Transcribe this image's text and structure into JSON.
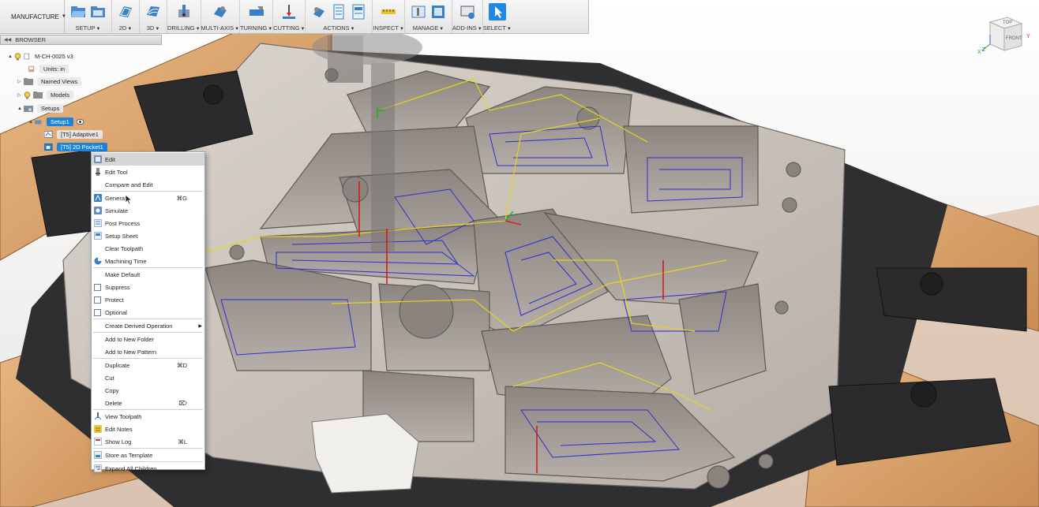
{
  "toolbar": {
    "workspace": "MANUFACTURE",
    "groups": [
      {
        "label": "SETUP",
        "icons": [
          "folder-open-icon",
          "folder-setup-icon"
        ]
      },
      {
        "label": "2D",
        "icons": [
          "2d-contour-icon"
        ]
      },
      {
        "label": "3D",
        "icons": [
          "3d-surface-icon"
        ]
      },
      {
        "label": "DRILLING",
        "icons": [
          "drill-icon"
        ]
      },
      {
        "label": "MULTI-AXIS",
        "icons": [
          "multi-axis-icon"
        ]
      },
      {
        "label": "TURNING",
        "icons": [
          "turning-icon"
        ]
      },
      {
        "label": "CUTTING",
        "icons": [
          "cutting-icon"
        ]
      },
      {
        "label": "ACTIONS",
        "icons": [
          "simulate-action-icon",
          "post-process-icon",
          "setup-sheet-icon"
        ]
      },
      {
        "label": "INSPECT",
        "icons": [
          "measure-icon"
        ]
      },
      {
        "label": "MANAGE",
        "icons": [
          "tool-library-icon",
          "template-icon"
        ]
      },
      {
        "label": "ADD-INS",
        "icons": [
          "add-ins-icon"
        ]
      },
      {
        "label": "SELECT",
        "icons": [
          "select-cursor-icon"
        ]
      }
    ],
    "colors": {
      "active": "#1e88e5",
      "icon_blue": "#3b7fc4"
    }
  },
  "viewcube": {
    "top": "TOP",
    "front": "FRONT",
    "axes": [
      "X",
      "Y",
      "Z"
    ]
  },
  "browser": {
    "title": "BROWSER",
    "root": "M-CH-0025 v3",
    "units": "Units: in",
    "named_views": "Named Views",
    "models": "Models",
    "setups": "Setups",
    "setup1": "Setup1",
    "op1": "[T5] Adaptive1",
    "op2": "[T5] 2D Pocket1"
  },
  "context_menu": {
    "items": [
      {
        "label": "Edit",
        "icon": "edit-icon",
        "highlighted": true
      },
      {
        "label": "Edit Tool",
        "icon": "edit-tool-icon"
      },
      {
        "label": "Compare and Edit",
        "icon": ""
      },
      {
        "label": "Generate",
        "icon": "generate-icon",
        "shortcut": "⌘G"
      },
      {
        "label": "Simulate",
        "icon": "simulate-icon"
      },
      {
        "label": "Post Process",
        "icon": "post-process-icon"
      },
      {
        "label": "Setup Sheet",
        "icon": "setup-sheet-icon"
      },
      {
        "label": "Clear Toolpath",
        "icon": ""
      },
      {
        "label": "Machining Time",
        "icon": "machining-time-icon"
      },
      {
        "label": "Make Default",
        "icon": ""
      },
      {
        "label": "Suppress",
        "checkbox": true
      },
      {
        "label": "Protect",
        "checkbox": true
      },
      {
        "label": "Optional",
        "checkbox": true
      },
      {
        "label": "Create Derived Operation",
        "submenu": true
      },
      {
        "label": "Add to New Folder",
        "icon": ""
      },
      {
        "label": "Add to New Pattern",
        "icon": ""
      },
      {
        "label": "Duplicate",
        "icon": "",
        "shortcut": "⌘D"
      },
      {
        "label": "Cut",
        "icon": ""
      },
      {
        "label": "Copy",
        "icon": ""
      },
      {
        "label": "Delete",
        "icon": "",
        "shortcut": "⌦"
      },
      {
        "label": "View Toolpath",
        "icon": "view-toolpath-icon"
      },
      {
        "label": "Edit Notes",
        "icon": "edit-notes-icon"
      },
      {
        "label": "Show Log",
        "icon": "show-log-icon",
        "shortcut": "⌘L"
      },
      {
        "label": "Store as Template",
        "icon": "store-template-icon"
      },
      {
        "label": "Expand All Children",
        "icon": "expand-children-icon"
      }
    ]
  }
}
